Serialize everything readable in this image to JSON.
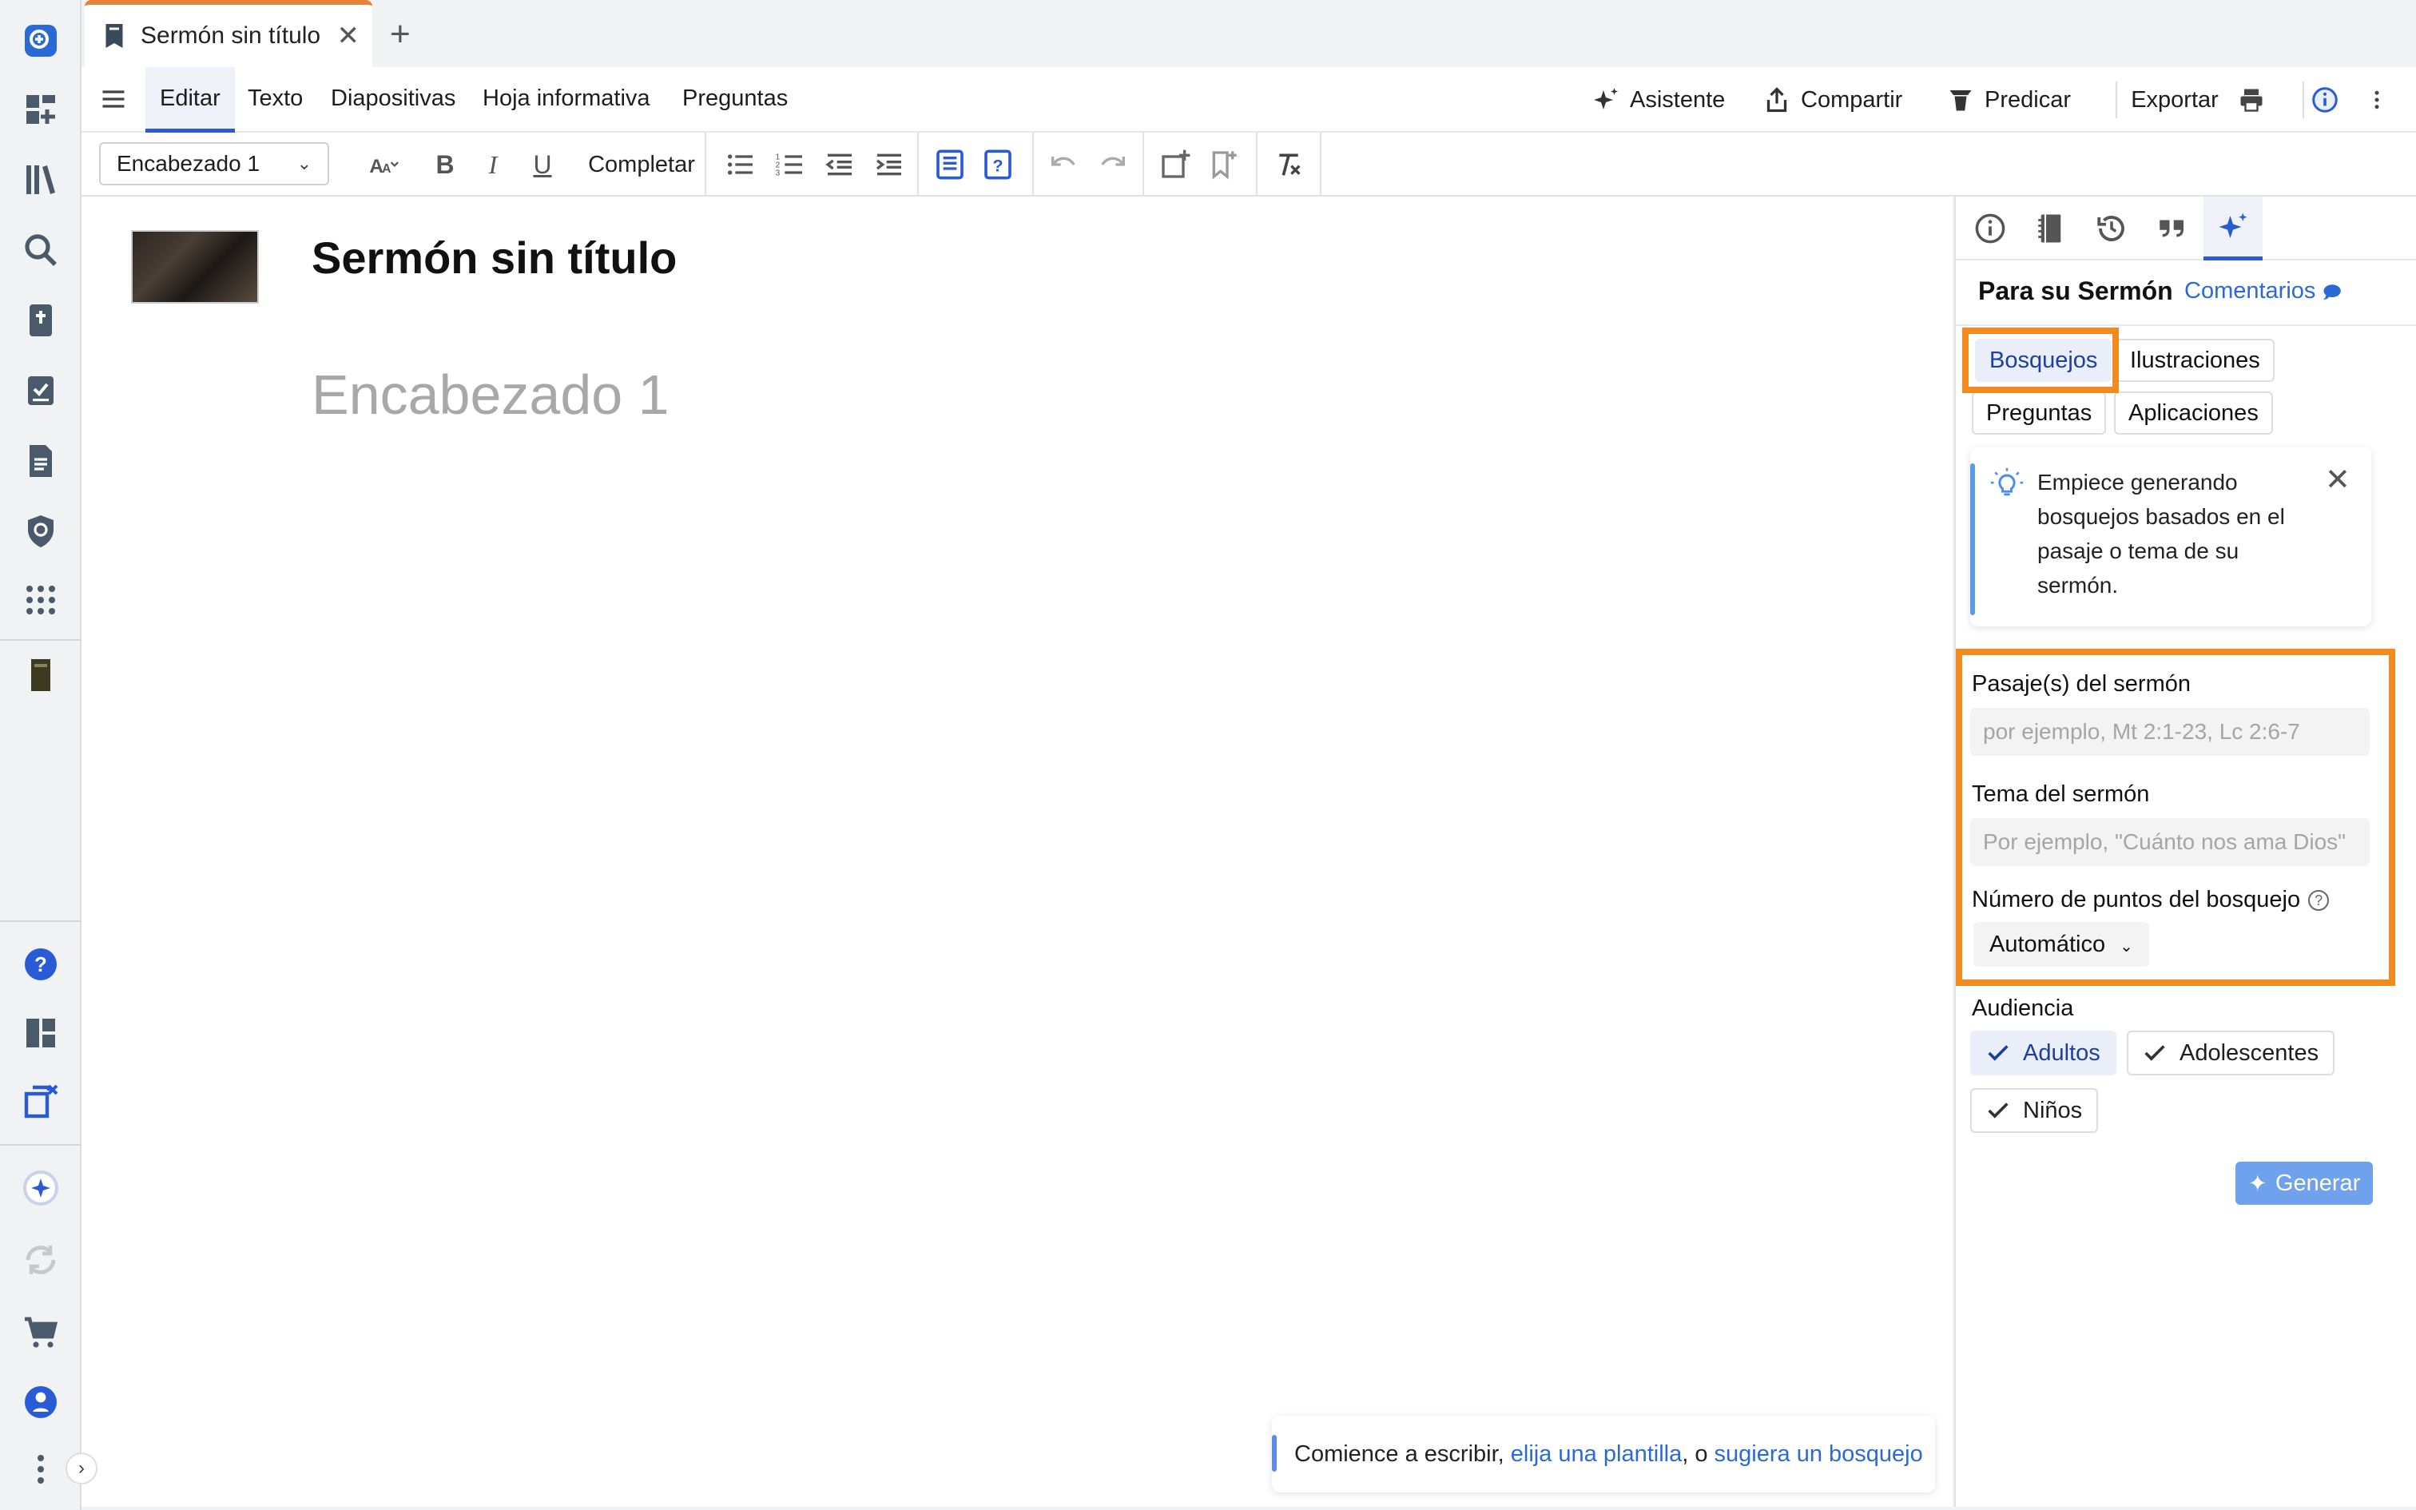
{
  "tab": {
    "title": "Sermón sin título"
  },
  "menu": {
    "items": [
      "Editar",
      "Texto",
      "Diapositivas",
      "Hoja informativa",
      "Preguntas"
    ],
    "right": {
      "assistant": "Asistente",
      "share": "Compartir",
      "preach": "Predicar",
      "export": "Exportar"
    }
  },
  "toolbar": {
    "style_value": "Encabezado 1",
    "complete": "Completar"
  },
  "editor": {
    "title": "Sermón sin título",
    "heading_placeholder": "Encabezado 1",
    "hint_prefix": "Comience a escribir, ",
    "hint_link1": "elija una plantilla",
    "hint_mid": ", o ",
    "hint_link2": "sugiera un bosquejo"
  },
  "panel": {
    "title": "Para su Sermón",
    "comments_link": "Comentarios",
    "chips": [
      "Bosquejos",
      "Ilustraciones",
      "Preguntas",
      "Aplicaciones"
    ],
    "tip": "Empiece generando bosquejos basados en el pasaje o tema de su sermón.",
    "passage_label": "Pasaje(s) del sermón",
    "passage_placeholder": "por ejemplo, Mt 2:1-23, Lc 2:6-7",
    "topic_label": "Tema del sermón",
    "topic_placeholder": "Por ejemplo, \"Cuánto nos ama Dios\"",
    "points_label": "Número de puntos del bosquejo",
    "points_value": "Automático",
    "audience_label": "Audiencia",
    "audience": [
      "Adultos",
      "Adolescentes",
      "Niños"
    ],
    "generate": "Generar"
  },
  "colors": {
    "accent": "#2a5bd7",
    "highlight": "#f28a1e",
    "tab_top": "#e8823a"
  }
}
